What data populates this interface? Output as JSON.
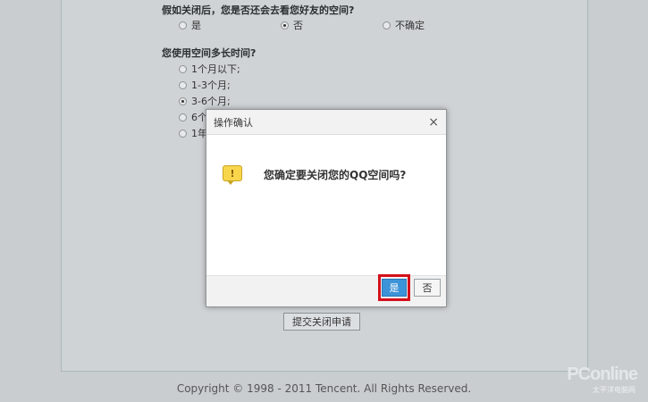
{
  "form": {
    "q1": {
      "title": "假如关闭后，您是否还会去看您好友的空间?",
      "options": [
        "是",
        "否",
        "不确定"
      ]
    },
    "q2": {
      "title": "您使用空间多长时间?",
      "options": [
        "1个月以下;",
        "1-3个月;",
        "3-6个月;",
        "6个",
        "1年"
      ]
    },
    "submit_label": "提交关闭申请"
  },
  "dialog": {
    "title": "操作确认",
    "close_icon": "×",
    "message": "您确定要关闭您的QQ空间吗?",
    "warning_icon": "!",
    "yes_label": "是",
    "no_label": "否",
    "highlight_color": "#d5101a",
    "yes_color": "#3d93d7"
  },
  "footer": {
    "copyright": "Copyright © 1998 - 2011 Tencent. All Rights Reserved."
  },
  "watermark": {
    "brand": "PConline",
    "sub": "太平洋电脑网"
  }
}
